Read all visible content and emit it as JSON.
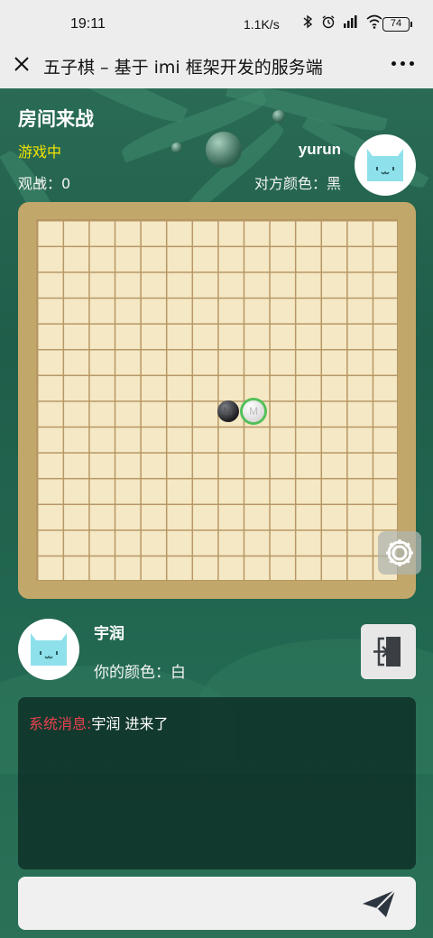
{
  "status_bar": {
    "time": "19:11",
    "network_speed": "1.1K/s",
    "battery": "74",
    "icons": [
      "bluetooth-icon",
      "alarm-icon",
      "hd-signal-icon",
      "wifi-icon"
    ]
  },
  "title_bar": {
    "title": "五子棋 – 基于 imi 框架开发的服务端"
  },
  "room": {
    "title": "房间来战",
    "status": "游戏中",
    "spectators_label": "观战：",
    "spectators_count": "0"
  },
  "opponent": {
    "name": "yurun",
    "color_label": "对方颜色：黑"
  },
  "player": {
    "name": "宇润",
    "color_label": "你的颜色：白"
  },
  "board": {
    "size": 15,
    "stones": [
      {
        "color": "black",
        "col": 7,
        "row": 7,
        "label": "M"
      },
      {
        "color": "white",
        "col": 8,
        "row": 7,
        "label": "M",
        "last_move": true
      }
    ]
  },
  "chat": {
    "messages": [
      {
        "sender": "系统消息:",
        "text": "宇润 进来了"
      }
    ]
  },
  "input": {
    "placeholder": ""
  },
  "colors": {
    "status_yellow": "#f3e400",
    "system_red": "#e8414d",
    "last_move_ring": "#52c05a"
  }
}
